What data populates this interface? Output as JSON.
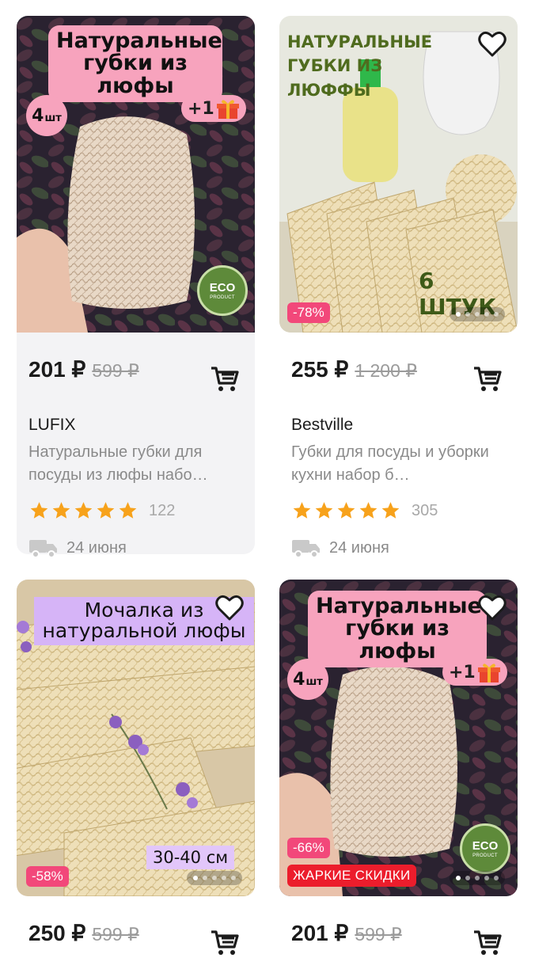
{
  "products": [
    {
      "image_banner_line1": "Натуральные",
      "image_banner_line2": "губки из люфы",
      "pack_badge_number": "4",
      "pack_badge_unit": "шт",
      "gift_badge": "+1",
      "eco_badge": "ECO",
      "eco_badge_sub": "PRODUCT",
      "price": "201 ₽",
      "old_price": "599 ₽",
      "brand": "LUFIX",
      "description": "Натуральные губки для посуды из люфы набо…",
      "rating": 5,
      "reviews": "122",
      "delivery": "24 июня",
      "cart_icon": "cart-icon"
    },
    {
      "image_banner": "НАТУРАЛЬНЫЕ ГУБКИ ИЗ ЛЮФФЫ",
      "image_banner_line1": "НАТУРАЛЬНЫЕ ГУБКИ ИЗ",
      "image_banner_line2": "ЛЮФФЫ",
      "image_caption": "6 ШТУК",
      "discount": "-78%",
      "carousel_dots": 5,
      "carousel_active": 1,
      "price": "255 ₽",
      "old_price": "1 200 ₽",
      "brand": "Bestville",
      "description": "Губки для посуды и уборки кухни набор б…",
      "rating": 5,
      "reviews": "305",
      "delivery": "24 июня",
      "favorite_icon": "heart-outline-icon"
    },
    {
      "image_banner_line1": "Мочалка из",
      "image_banner_line2": "натуральной люфы",
      "size_tag": "30-40 см",
      "discount": "-58%",
      "carousel_dots": 5,
      "carousel_active": 1,
      "price": "250 ₽",
      "old_price": "599 ₽",
      "favorite_icon": "heart-outline-icon"
    },
    {
      "image_banner_line1": "Натуральные",
      "image_banner_line2": "губки из люфы",
      "pack_badge_number": "4",
      "pack_badge_unit": "шт",
      "gift_badge": "+1",
      "eco_badge": "ECO",
      "eco_badge_sub": "PRODUCT",
      "discount": "-66%",
      "hot_label": "ЖАРКИЕ СКИДКИ",
      "carousel_dots": 5,
      "carousel_active": 1,
      "price": "201 ₽",
      "old_price": "599 ₽",
      "favorite_icon": "heart-outline-icon"
    }
  ],
  "colors": {
    "discount_pink": "#f2487a",
    "hot_red": "#ec1d2c",
    "star": "#f7a21b",
    "banner_pink": "#f7a3bd",
    "banner_purple": "#d6b4f7"
  }
}
